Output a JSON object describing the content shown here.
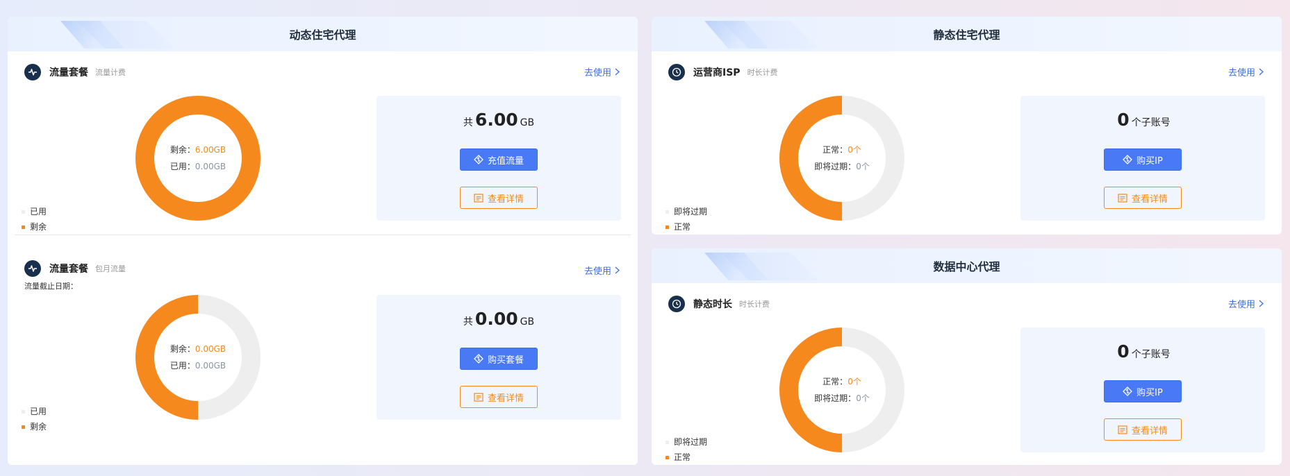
{
  "colors": {
    "orange": "#f5891e",
    "blue": "#4a79f5",
    "grey": "#eeeeee",
    "navy": "#19304d"
  },
  "panels": {
    "dynamic": {
      "title": "动态住宅代理",
      "sections": [
        {
          "icon": "pulse-icon",
          "title": "流量套餐",
          "subtitle": "流量计费",
          "link": "去使用",
          "note": "",
          "center": {
            "line1_label": "剩余：",
            "line1_value": "6.00GB",
            "line2_label": "已用：",
            "line2_value": "0.00GB"
          },
          "legend": [
            "已用",
            "剩余"
          ],
          "total_prefix": "共",
          "total_value": "6.00",
          "total_unit": "GB",
          "primary_button": "充值流量",
          "secondary_button": "查看详情",
          "donut_fraction": 1.0
        },
        {
          "icon": "pulse-icon",
          "title": "流量套餐",
          "subtitle": "包月流量",
          "link": "去使用",
          "note": "流量截止日期：",
          "center": {
            "line1_label": "剩余：",
            "line1_value": "0.00GB",
            "line2_label": "已用：",
            "line2_value": "0.00GB"
          },
          "legend": [
            "已用",
            "剩余"
          ],
          "total_prefix": "共",
          "total_value": "0.00",
          "total_unit": "GB",
          "primary_button": "购买套餐",
          "secondary_button": "查看详情",
          "donut_fraction": 0.5
        }
      ]
    },
    "static": {
      "title": "静态住宅代理",
      "section": {
        "icon": "clock-icon",
        "title": "运营商ISP",
        "subtitle": "时长计费",
        "link": "去使用",
        "center": {
          "line1_label": "正常：",
          "line1_value": "0个",
          "line2_label": "即将过期：",
          "line2_value": "0个"
        },
        "legend": [
          "即将过期",
          "正常"
        ],
        "total_value": "0",
        "total_unit": "个子账号",
        "primary_button": "购买IP",
        "secondary_button": "查看详情",
        "donut_fraction": 0.5
      }
    },
    "datacenter": {
      "title": "数据中心代理",
      "section": {
        "icon": "clock-icon",
        "title": "静态时长",
        "subtitle": "时长计费",
        "link": "去使用",
        "center": {
          "line1_label": "正常：",
          "line1_value": "0个",
          "line2_label": "即将过期：",
          "line2_value": "0个"
        },
        "legend": [
          "即将过期",
          "正常"
        ],
        "total_value": "0",
        "total_unit": "个子账号",
        "primary_button": "购买IP",
        "secondary_button": "查看详情",
        "donut_fraction": 0.5
      }
    }
  }
}
